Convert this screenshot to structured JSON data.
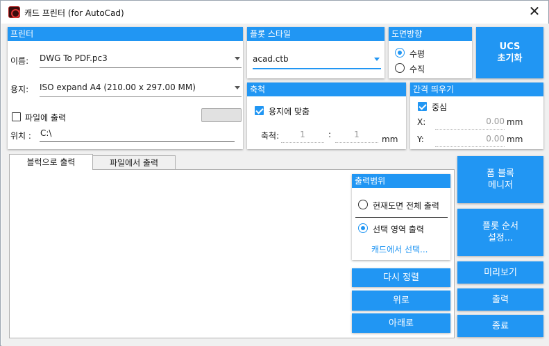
{
  "window": {
    "title": "캐드 프린터 (for AutoCad)"
  },
  "printer": {
    "header": "프린터",
    "name_label": "이름:",
    "name_value": "DWG To PDF.pc3",
    "paper_label": "용지:",
    "paper_value": "ISO expand A4 (210.00 x 297.00 MM)",
    "print_to_file_label": "파일에 출력",
    "print_to_file_checked": false,
    "location_label": "위치 :",
    "location_value": "C:\\"
  },
  "plot_style": {
    "header": "플롯 스타일",
    "value": "acad.ctb"
  },
  "orientation": {
    "header": "도면방향",
    "options": [
      {
        "label": "수평",
        "selected": true
      },
      {
        "label": "수직",
        "selected": false
      }
    ]
  },
  "ucs_button": {
    "label": "UCS\n초기화"
  },
  "scale": {
    "header": "축척",
    "fit_label": "용지에 맞춤",
    "fit_checked": true,
    "scale_label": "축척:",
    "value_left": "1",
    "separator": ":",
    "value_right": "1",
    "unit": "mm"
  },
  "offset": {
    "header": "간격 띄우기",
    "center_label": "중심",
    "center_checked": true,
    "x_label": "X:",
    "x_value": "0.00",
    "y_label": "Y:",
    "y_value": "0.00",
    "unit": "mm"
  },
  "tabs": [
    {
      "label": "블럭으로 출력",
      "active": true
    },
    {
      "label": "파일에서 출력",
      "active": false
    }
  ],
  "print_range": {
    "header": "출력범위",
    "options": [
      {
        "label": "현재도면 전체 출력",
        "selected": false
      },
      {
        "label": "선택 영역 출력",
        "selected": true
      }
    ],
    "select_link": "캐드에서 선택..."
  },
  "list_buttons": {
    "sort": "다시 정렬",
    "up": "위로",
    "down": "아래로"
  },
  "right_buttons": {
    "form_block_manager": "폼 블록\n메니저",
    "plot_order": "플롯 순서\n설정...",
    "preview": "미리보기",
    "print": "출력",
    "exit": "종료"
  },
  "colors": {
    "accent": "#2196f3",
    "background": "#f0f0f0"
  }
}
